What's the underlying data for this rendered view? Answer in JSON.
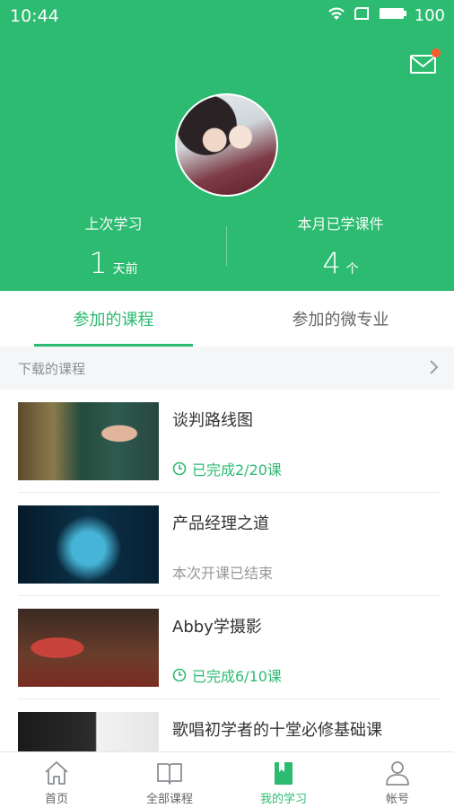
{
  "status_bar": {
    "time": "10:44",
    "battery": "100"
  },
  "profile": {
    "stats": [
      {
        "label": "上次学习",
        "value": "1",
        "unit": "天前"
      },
      {
        "label": "本月已学课件",
        "value": "4",
        "unit": "个"
      }
    ]
  },
  "tabs": [
    {
      "label": "参加的课程",
      "active": true
    },
    {
      "label": "参加的微专业",
      "active": false
    }
  ],
  "downloads": {
    "label": "下载的课程"
  },
  "courses": [
    {
      "title": "谈判路线图",
      "status": "已完成2/20课",
      "status_type": "progress"
    },
    {
      "title": "产品经理之道",
      "status": "本次开课已结束",
      "status_type": "ended"
    },
    {
      "title": "Abby学摄影",
      "status": "已完成6/10课",
      "status_type": "progress"
    },
    {
      "title": "歌唱初学者的十堂必修基础课",
      "status": "",
      "status_type": "none"
    }
  ],
  "bottom_nav": [
    {
      "label": "首页",
      "icon": "home-icon"
    },
    {
      "label": "全部课程",
      "icon": "book-icon"
    },
    {
      "label": "我的学习",
      "icon": "bookmark-icon",
      "active": true
    },
    {
      "label": "帐号",
      "icon": "person-icon"
    }
  ],
  "colors": {
    "accent": "#2dbb71",
    "notification_dot": "#ff5a2a"
  }
}
